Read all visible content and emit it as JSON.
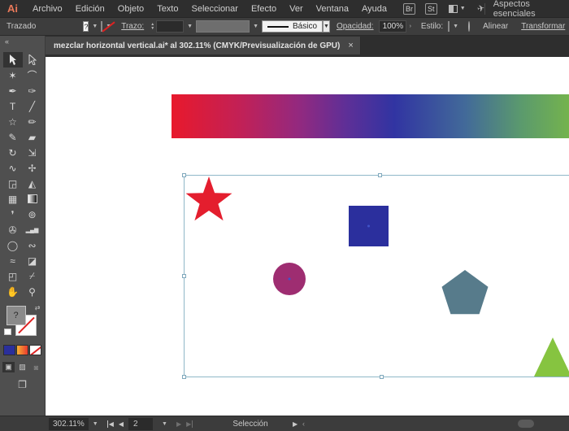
{
  "menubar": {
    "logo": "Ai",
    "items": [
      "Archivo",
      "Edición",
      "Objeto",
      "Texto",
      "Seleccionar",
      "Efecto",
      "Ver",
      "Ventana",
      "Ayuda"
    ],
    "bridge_badge": "Br",
    "stock_badge": "St",
    "workspace_label": "Aspectos esenciales"
  },
  "controlbar": {
    "selection_label": "Trazado",
    "fill_value": "?",
    "stroke_weight_label": "Trazo:",
    "brush_value": "Básico",
    "opacity_label": "Opacidad:",
    "opacity_value": "100%",
    "opacity_more": "›",
    "style_label": "Estilo:",
    "align_label": "Alinear",
    "transform_label": "Transformar"
  },
  "tab": {
    "title": "mezclar horizontal vertical.ai* al 302.11% (CMYK/Previsualización de GPU)",
    "close_glyph": "×"
  },
  "toolbar": {
    "collapse_glyph": "« ",
    "fill_question": "?",
    "swap_glyph": "⇄",
    "color_button_fill": "#2a2f9c",
    "screen_mode_glyph": "❐",
    "tools": [
      {
        "name": "selection",
        "special": "arrow-filled",
        "active": true
      },
      {
        "name": "direct-selection",
        "special": "arrow-outline"
      },
      {
        "name": "magic-wand",
        "glyph": "✶"
      },
      {
        "name": "lasso",
        "glyph": "⌒"
      },
      {
        "name": "pen",
        "glyph": "✒"
      },
      {
        "name": "curvature",
        "glyph": "✑"
      },
      {
        "name": "type",
        "glyph": "T"
      },
      {
        "name": "line-segment",
        "glyph": "╱"
      },
      {
        "name": "star-shape",
        "glyph": "☆"
      },
      {
        "name": "paintbrush",
        "glyph": "✏"
      },
      {
        "name": "shaper",
        "glyph": "✎"
      },
      {
        "name": "eraser",
        "glyph": "▰"
      },
      {
        "name": "rotate",
        "glyph": "↻"
      },
      {
        "name": "scale",
        "glyph": "⇲"
      },
      {
        "name": "width",
        "glyph": "∿"
      },
      {
        "name": "puppet-warp",
        "glyph": "✢"
      },
      {
        "name": "shape-builder",
        "glyph": "◲"
      },
      {
        "name": "perspective-grid",
        "glyph": "◭"
      },
      {
        "name": "mesh",
        "glyph": "▦"
      },
      {
        "name": "gradient",
        "special": "gradient-swatch"
      },
      {
        "name": "eyedropper",
        "glyph": "❜"
      },
      {
        "name": "rotate-view",
        "glyph": "⊚"
      },
      {
        "name": "symbol-sprayer",
        "glyph": "✇"
      },
      {
        "name": "column-graph",
        "glyph": "▂▄▆",
        "small": true
      },
      {
        "name": "blob-brush",
        "glyph": "◯"
      },
      {
        "name": "blend",
        "glyph": "∾"
      },
      {
        "name": "smooth",
        "glyph": "≈"
      },
      {
        "name": "path-eraser",
        "glyph": "◪"
      },
      {
        "name": "artboard",
        "glyph": "◰"
      },
      {
        "name": "slice",
        "glyph": "⌿"
      },
      {
        "name": "hand",
        "glyph": "✋"
      },
      {
        "name": "zoom",
        "glyph": "⚲"
      }
    ]
  },
  "canvas": {
    "gradient_stops": [
      "#e8192c",
      "#c02158",
      "#93297f",
      "#5e2f97",
      "#3134a2",
      "#426a99",
      "#5b9a6d",
      "#74b34d"
    ],
    "star_fill": "#e41e2e",
    "square_fill": "#2b2f9d",
    "square_stroke": "#20247f",
    "circle_fill": "#9e2d71",
    "circle_stroke": "#8c2a86",
    "pentagon_fill": "#577b8b",
    "pentagon_stroke": "#4a6a7a",
    "triangle_fill": "#86c440",
    "triangle_stroke": "#79b13a",
    "center_dot_color": "#4053c8"
  },
  "statusbar": {
    "zoom_value": "302.11%",
    "first_glyph": "◀",
    "prev_glyph": "◀",
    "artboard_value": "2",
    "next_glyph": "▶",
    "last_glyph": "▶",
    "status_text": "Selección",
    "menu_arrow": "▶",
    "scroll_left_glyph": "‹"
  }
}
